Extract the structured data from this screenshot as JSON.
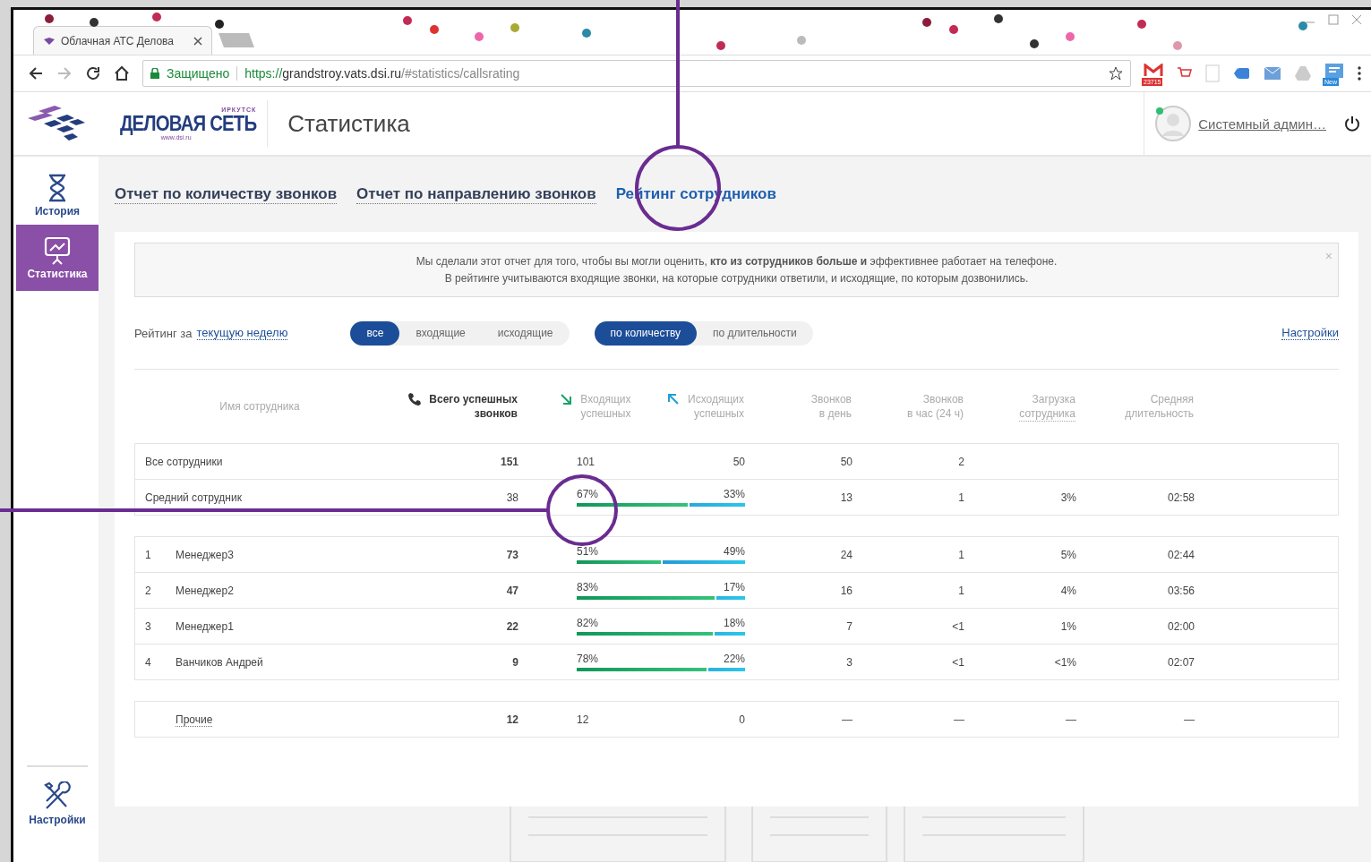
{
  "browser": {
    "tab_title": "Облачная АТС Делова",
    "security": "Защищено",
    "url_scheme": "https://",
    "url_host": "grandstroy.vats.dsi.ru",
    "url_path": "/#statistics/callsrating",
    "extension_badges": [
      "23715",
      "New"
    ]
  },
  "header": {
    "logo": {
      "city": "ИРКУТСК",
      "name": "ДЕЛОВАЯ СЕТЬ",
      "site": "www.dsi.ru"
    },
    "title": "Статистика",
    "user": {
      "name": "Системный админ…",
      "online": true
    }
  },
  "sidebar": {
    "items": [
      {
        "label": "История",
        "kind": "history",
        "selected": false
      },
      {
        "label": "Статистика",
        "kind": "stats",
        "selected": true
      }
    ],
    "bottom_item": {
      "label": "Настройки"
    }
  },
  "tabs": [
    {
      "label": "Отчет по количеству звонков",
      "selected": false
    },
    {
      "label": "Отчет по направлению звонков",
      "selected": false
    },
    {
      "label": "Рейтинг сотрудников",
      "selected": true
    }
  ],
  "notice": {
    "lines": [
      "Мы сделали этот отчет для того, чтобы вы могли оценить, **кто из сотрудников больше и** эффективнее работает на телефоне.",
      "В рейтинге учитываются входящие звонки, на которые сотрудники ответили, и исходящие, по которым дозвонились."
    ],
    "close": "×"
  },
  "filters": {
    "period_label": "Рейтинг за",
    "period": "текущую неделю",
    "direction": [
      {
        "label": "все",
        "selected": true
      },
      {
        "label": "входящие",
        "selected": false
      },
      {
        "label": "исходящие",
        "selected": false
      }
    ],
    "measure": [
      {
        "label": "по количеству",
        "selected": true
      },
      {
        "label": "по длительности",
        "selected": false
      }
    ],
    "settings": "Настройки"
  },
  "table": {
    "columns": [
      {
        "kind": "name",
        "lines": [
          "Имя сотрудника"
        ]
      },
      {
        "kind": "total",
        "lines": [
          "Всего успешных",
          "звонков"
        ]
      },
      {
        "kind": "incoming",
        "lines": [
          "Входящих",
          "успешных"
        ]
      },
      {
        "kind": "outgoing",
        "lines": [
          "Исходящих",
          "успешных"
        ]
      },
      {
        "kind": "per_day",
        "lines": [
          "Звонков",
          "в день"
        ]
      },
      {
        "kind": "per_hour",
        "lines": [
          "Звонков",
          "в час (24 ч)"
        ]
      },
      {
        "kind": "load",
        "lines": [
          "Загрузка",
          "сотрудника"
        ]
      },
      {
        "kind": "avg",
        "lines": [
          "Средняя",
          "длительность"
        ]
      }
    ],
    "summary": [
      {
        "name": "Все сотрудники",
        "total": "151",
        "total_bold": true,
        "incoming": "101",
        "outgoing": "50",
        "per_day": "50",
        "per_hour": "2"
      },
      {
        "name": "Средний сотрудник",
        "total": "38",
        "total_bold": false,
        "incoming": "67%",
        "outgoing": "33%",
        "level": 0.67,
        "per_day": "13",
        "per_hour": "1",
        "load": "3%",
        "avg_duration": "02:58"
      }
    ],
    "rows": [
      {
        "rank": "1",
        "name": "Менеджер3",
        "total": "73",
        "incoming": "51%",
        "outgoing": "49%",
        "level": 0.51,
        "per_day": "24",
        "per_hour": "1",
        "load": "5%",
        "avg_duration": "02:44"
      },
      {
        "rank": "2",
        "name": "Менеджер2",
        "total": "47",
        "incoming": "83%",
        "outgoing": "17%",
        "level": 0.83,
        "per_day": "16",
        "per_hour": "1",
        "load": "4%",
        "avg_duration": "03:56"
      },
      {
        "rank": "3",
        "name": "Менеджер1",
        "total": "22",
        "incoming": "82%",
        "outgoing": "18%",
        "level": 0.82,
        "per_day": "7",
        "per_hour": "<1",
        "load": "1%",
        "avg_duration": "02:00"
      },
      {
        "rank": "4",
        "name": "Ванчиков Андрей",
        "total": "9",
        "incoming": "78%",
        "outgoing": "22%",
        "level": 0.78,
        "per_day": "3",
        "per_hour": "<1",
        "load": "<1%",
        "avg_duration": "02:07"
      }
    ],
    "others": {
      "name": "Прочие",
      "total": "12",
      "incoming": "12",
      "outgoing": "0",
      "per_day": "—",
      "per_hour": "—",
      "load": "—",
      "avg_duration": "—"
    }
  }
}
